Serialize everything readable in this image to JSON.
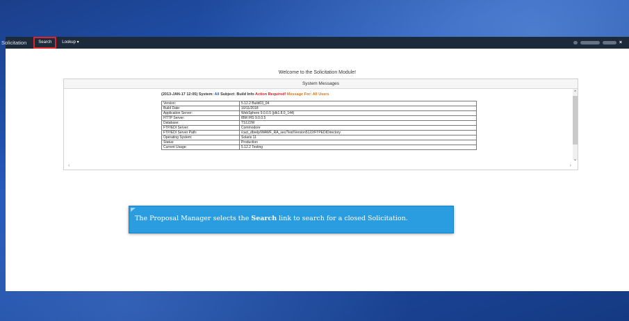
{
  "navbar": {
    "brand": "Solicitation",
    "links": [
      "Search",
      "Lookup ▾"
    ],
    "close": "×"
  },
  "main": {
    "welcome": "Welcome to the Solicitation Module!",
    "panel_title": "System Messages",
    "message": {
      "date": "(2013-JAN-17 12:05)",
      "system_label": "System:",
      "system_value": "All",
      "subject_label": "Subject:",
      "subject_value": "Build Info",
      "action": "Action Required!",
      "message_for": "Message For: All Users"
    },
    "info_rows": [
      {
        "k": "Version:",
        "v": "5.12.2 Build03_04"
      },
      {
        "k": "Build Date:",
        "v": "10/11/2018"
      },
      {
        "k": "Application Server:",
        "v": "WebSphere 9.0.0.5 (jdk1.8.0_144)"
      },
      {
        "k": "HTTP Server:",
        "v": "IBM IHS 9.0.0.5"
      },
      {
        "k": "Database:",
        "v": "TS122W"
      },
      {
        "k": "FTP/EDI Server:",
        "v": "Commodore"
      },
      {
        "k": "FTP/EDI Server Path:",
        "v": "/caci_dbrelp/WAWF_RA_sec/Test/Version5122/FTPEDIDirectory"
      },
      {
        "k": "Operating System:",
        "v": "Solaris 11"
      },
      {
        "k": "Status:",
        "v": "Production"
      },
      {
        "k": "Current Usage:",
        "v": "5.12.2 Testing"
      }
    ]
  },
  "callout": {
    "prefix": "The Proposal Manager selects the ",
    "bold": "Search",
    "suffix": " link to search for a closed Solicitation."
  },
  "colors": {
    "accent_blue": "#2a9de0",
    "highlight_red": "#e0242e",
    "navbar": "#1c2a3a"
  }
}
